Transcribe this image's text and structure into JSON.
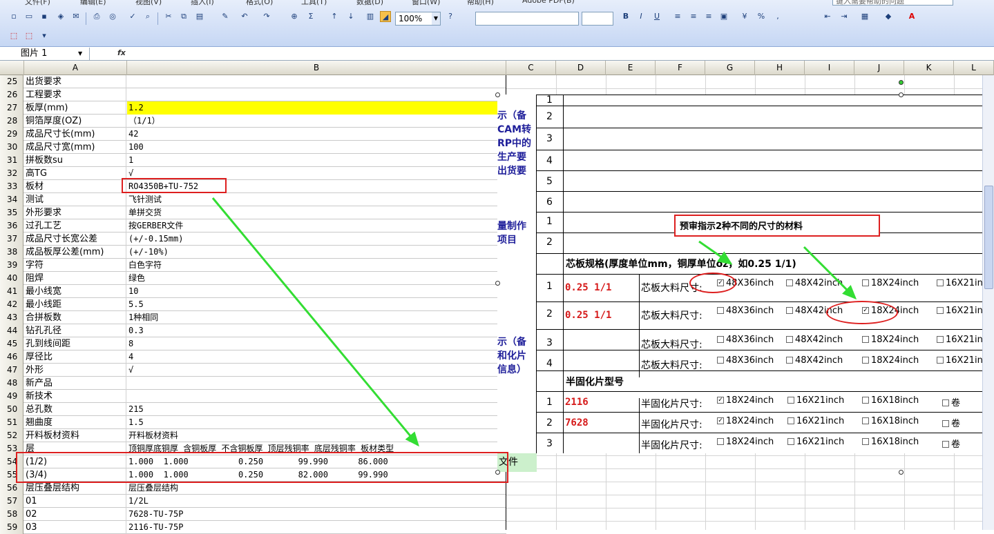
{
  "menu": [
    "文件(F)",
    "编辑(E)",
    "视图(V)",
    "插入(I)",
    "格式(O)",
    "工具(T)",
    "数据(D)",
    "窗口(W)",
    "帮助(H)",
    "Adobe PDF(B)"
  ],
  "help_search_placeholder": "键入需要帮助的问题",
  "zoom": "100%",
  "font_name": "",
  "font_size": "",
  "name_box": "图片 1",
  "fx_label": "fx",
  "columns": [
    "A",
    "B",
    "C",
    "D",
    "E",
    "F",
    "G",
    "H",
    "I",
    "J",
    "K",
    "L"
  ],
  "rows": [
    {
      "n": "25",
      "a": "出货要求",
      "b": ""
    },
    {
      "n": "26",
      "a": "工程要求",
      "b": ""
    },
    {
      "n": "27",
      "a": "板厚(mm)",
      "b": "1.2"
    },
    {
      "n": "28",
      "a": "铜箔厚度(OZ)",
      "b": "（1/1）"
    },
    {
      "n": "29",
      "a": "成品尺寸长(mm)",
      "b": "42"
    },
    {
      "n": "30",
      "a": "成品尺寸宽(mm)",
      "b": "100"
    },
    {
      "n": "31",
      "a": "拼板数su",
      "b": "1"
    },
    {
      "n": "32",
      "a": "高TG",
      "b": "√"
    },
    {
      "n": "33",
      "a": "板材",
      "b": "RO4350B+TU-752"
    },
    {
      "n": "34",
      "a": "测试",
      "b": "飞针测试"
    },
    {
      "n": "35",
      "a": "外形要求",
      "b": "单拼交货"
    },
    {
      "n": "36",
      "a": "过孔工艺",
      "b": "按GERBER文件"
    },
    {
      "n": "37",
      "a": "成品尺寸长宽公差",
      "b": "(+/-0.15mm)"
    },
    {
      "n": "38",
      "a": "成品板厚公差(mm)",
      "b": "(+/-10%)"
    },
    {
      "n": "39",
      "a": "字符",
      "b": "白色字符"
    },
    {
      "n": "40",
      "a": "阻焊",
      "b": "绿色"
    },
    {
      "n": "41",
      "a": "最小线宽",
      "b": "10"
    },
    {
      "n": "42",
      "a": "最小线距",
      "b": "5.5"
    },
    {
      "n": "43",
      "a": "合拼板数",
      "b": "1种相同"
    },
    {
      "n": "44",
      "a": "钻孔孔径",
      "b": "0.3"
    },
    {
      "n": "45",
      "a": "孔到线间距",
      "b": "8"
    },
    {
      "n": "46",
      "a": "厚径比",
      "b": "4"
    },
    {
      "n": "47",
      "a": "外形",
      "b": "√"
    },
    {
      "n": "48",
      "a": "新产品",
      "b": ""
    },
    {
      "n": "49",
      "a": "新技术",
      "b": ""
    },
    {
      "n": "50",
      "a": "总孔数",
      "b": "215"
    },
    {
      "n": "51",
      "a": "翘曲度",
      "b": "1.5"
    },
    {
      "n": "52",
      "a": "开料板材资料",
      "b": "开料板材资料"
    },
    {
      "n": "53",
      "a": "层",
      "b": "顶铜厚底铜厚 含铜板厚 不含铜板厚 顶层残铜率 底层残铜率 板材类型"
    },
    {
      "n": "54",
      "a": "(1/2)",
      "b": "1.000  1.000          0.250       99.990      86.000"
    },
    {
      "n": "55",
      "a": "(3/4)",
      "b": "1.000  1.000          0.250       82.000      99.990"
    },
    {
      "n": "56",
      "a": "层压叠层结构",
      "b": "层压叠层结构"
    },
    {
      "n": "57",
      "a": "01",
      "b": "1/2L"
    },
    {
      "n": "58",
      "a": "02",
      "b": "7628-TU-75P"
    },
    {
      "n": "59",
      "a": "03",
      "b": "2116-TU-75P"
    }
  ],
  "picture": {
    "left_fragments": [
      "示（备",
      "CAM转",
      "RP中的",
      "生产要",
      "出货要",
      "量制作",
      "项目",
      "示（备",
      "和化片",
      "信息）",
      "文件"
    ],
    "top_nums": [
      "1",
      "2",
      "3",
      "4",
      "5",
      "6"
    ],
    "qa_nums": [
      "1",
      "2"
    ],
    "annotation": "预审指示2种不同的尺寸的材料",
    "core_title": "芯板规格(厚度单位mm，铜厚单位oz，如0.25 1/1)",
    "core_label": "芯板大料尺寸:",
    "core_rows": [
      {
        "n": "1",
        "spec": "0.25 1/1",
        "checked": [
          true,
          false,
          false,
          false
        ]
      },
      {
        "n": "2",
        "spec": "0.25 1/1",
        "checked": [
          false,
          false,
          true,
          false
        ]
      },
      {
        "n": "3",
        "spec": "",
        "checked": [
          false,
          false,
          false,
          false
        ]
      },
      {
        "n": "4",
        "spec": "",
        "checked": [
          false,
          false,
          false,
          false
        ]
      }
    ],
    "core_opts": [
      "48X36inch",
      "48X42inch",
      "18X24inch",
      "16X21in"
    ],
    "pp_title": "半固化片型号",
    "pp_label": "半固化片尺寸:",
    "pp_rows": [
      {
        "n": "1",
        "spec": "2116",
        "checked": [
          true,
          false,
          false,
          false
        ]
      },
      {
        "n": "2",
        "spec": "7628",
        "checked": [
          true,
          false,
          false,
          false
        ]
      },
      {
        "n": "3",
        "spec": "",
        "checked": [
          false,
          false,
          false,
          false
        ]
      }
    ],
    "pp_opts": [
      "18X24inch",
      "16X21inch",
      "16X18inch",
      "卷"
    ]
  }
}
